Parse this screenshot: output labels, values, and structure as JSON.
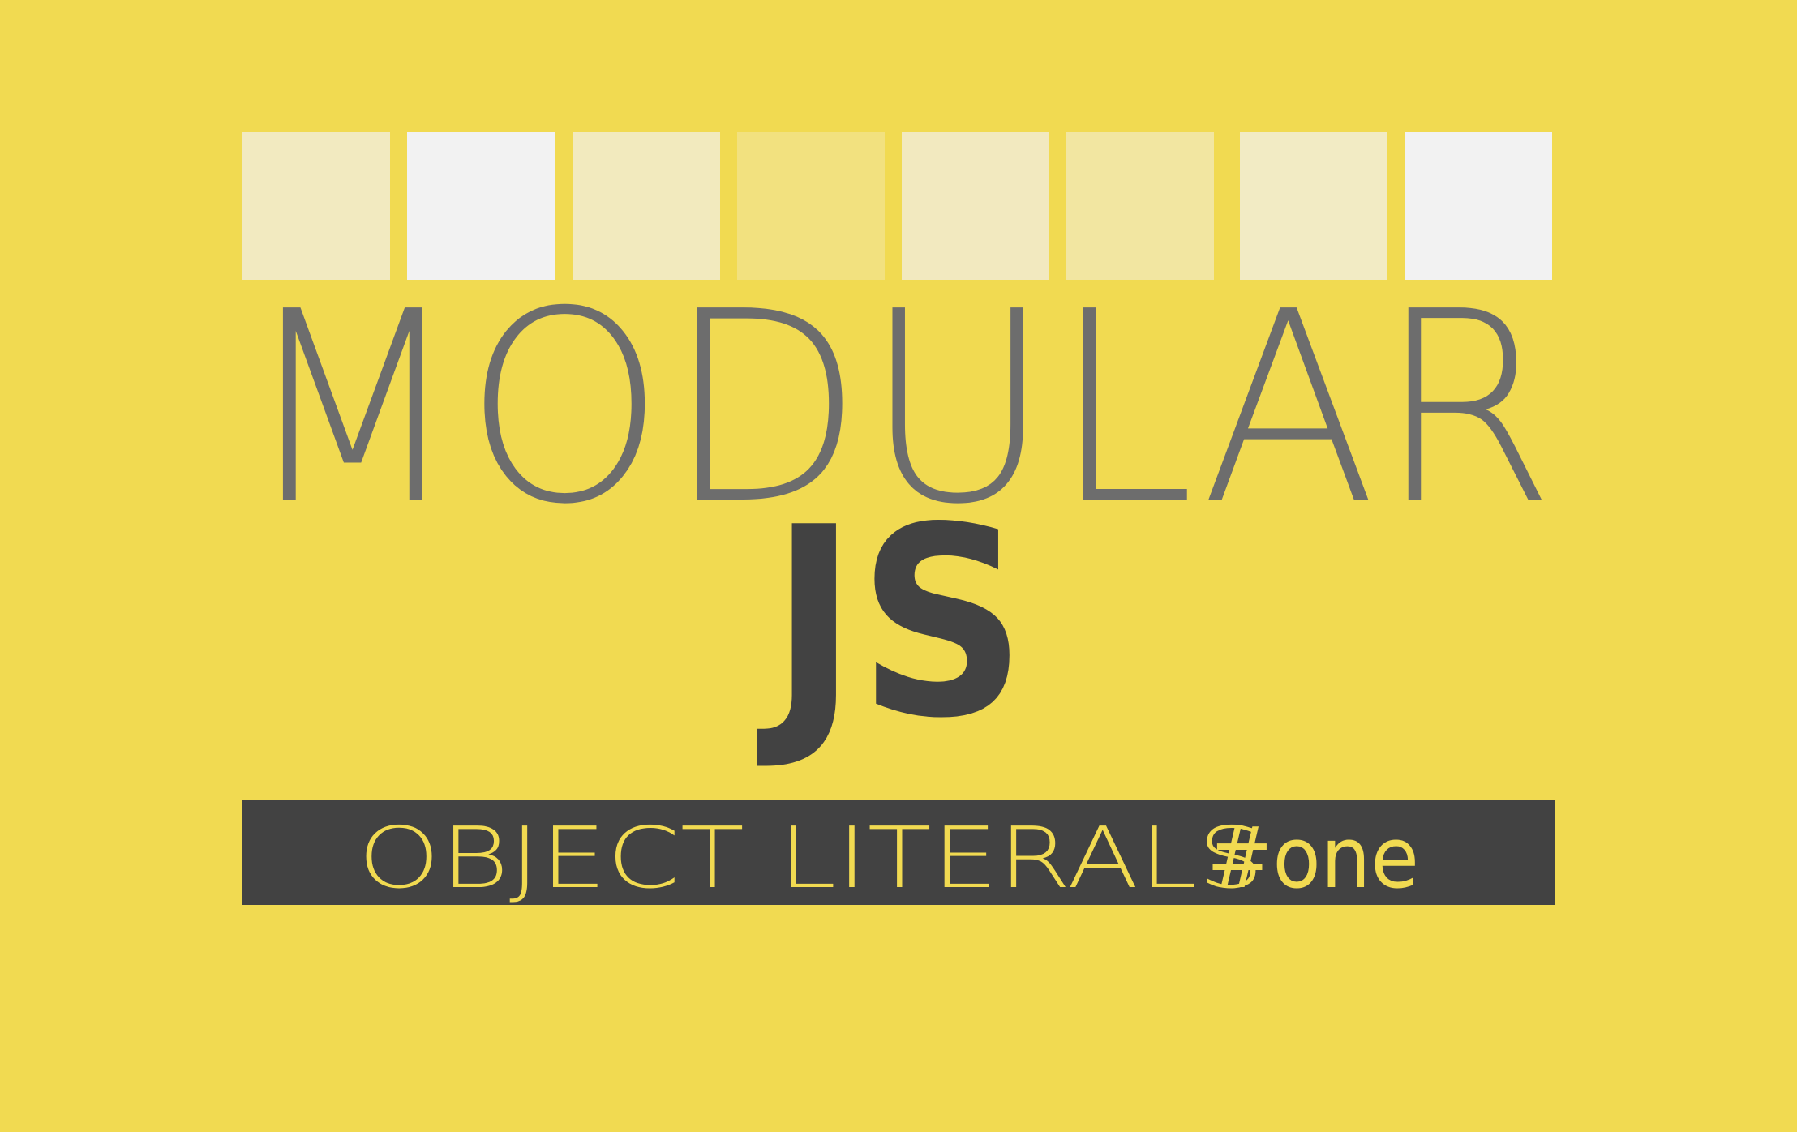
{
  "background_color": "#f1da51",
  "swatches": [
    {
      "color": "#f2eac0"
    },
    {
      "color": "#f2f2f2"
    },
    {
      "color": "#f2eabe"
    },
    {
      "color": "#f2e17f"
    },
    {
      "color": "#f2e9bf"
    },
    {
      "color": "#f2e6a1"
    },
    {
      "color": "#f2ebc4"
    },
    {
      "color": "#f2f2f2"
    }
  ],
  "title": {
    "main": "MODULAR",
    "main_color": "#6d6d6d",
    "sub": "JS",
    "sub_color": "#424242"
  },
  "banner": {
    "text": "OBJECT LITERALS",
    "hashtag": "#one",
    "text_color": "#f1da51",
    "background": "#424242"
  }
}
